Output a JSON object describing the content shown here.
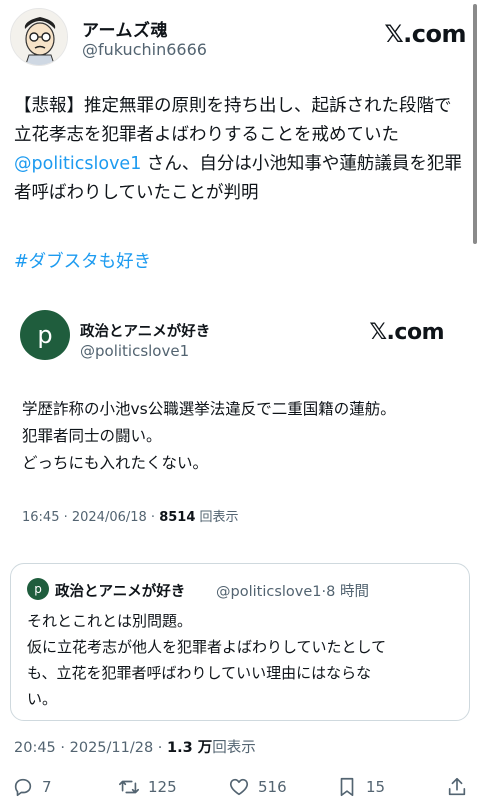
{
  "author": {
    "name": "アームズ魂",
    "handle": "@fukuchin6666",
    "site_logo": "𝕏.com"
  },
  "tweet": {
    "text_before": "【悲報】推定無罪の原則を持ち出し、起訴された段階で立花孝志を犯罪者よばわりすることを戒めていた",
    "mention": "@politicslove1",
    "text_after": " さん、自分は小池知事や蓮舫議員を犯罪者呼ばわりしていたことが判明",
    "hashtag": "#ダブスタも好き"
  },
  "embedded": {
    "avatar_letter": "p",
    "name": "政治とアニメが好き",
    "handle": "@politicslove1",
    "site_logo": "𝕏.com",
    "lines": [
      "学歴詐称の小池vs公職選挙法違反で二重国籍の蓮舫。",
      "犯罪者同士の闘い。",
      "どっちにも入れたくない。"
    ],
    "time": "16:45 · 2024/06/18 · ",
    "views_count": "8514",
    "views_label": " 回表示"
  },
  "quote": {
    "avatar_letter": "p",
    "name": "政治とアニメが好き",
    "handle_time": "@politicslove1·8 時間",
    "lines": [
      "それとこれとは別問題。",
      "仮に立花考志が他人を犯罪者よばわりしていたとして",
      "も、立花を犯罪者呼ばわりしていい理由にはならな",
      "い。"
    ]
  },
  "meta": {
    "time": "20:45 · 2025/11/28 · ",
    "views_count": "1.3 万",
    "views_label": "回表示"
  },
  "actions": {
    "replies": "7",
    "reposts": "125",
    "likes": "516",
    "bookmarks": "15"
  },
  "colors": {
    "link": "#1d9bf0",
    "secondary": "#536471",
    "border": "#cfd9de",
    "avatar_green": "#1f5d3d"
  },
  "icons": [
    "reply-icon",
    "repost-icon",
    "like-icon",
    "bookmark-icon",
    "share-icon"
  ]
}
